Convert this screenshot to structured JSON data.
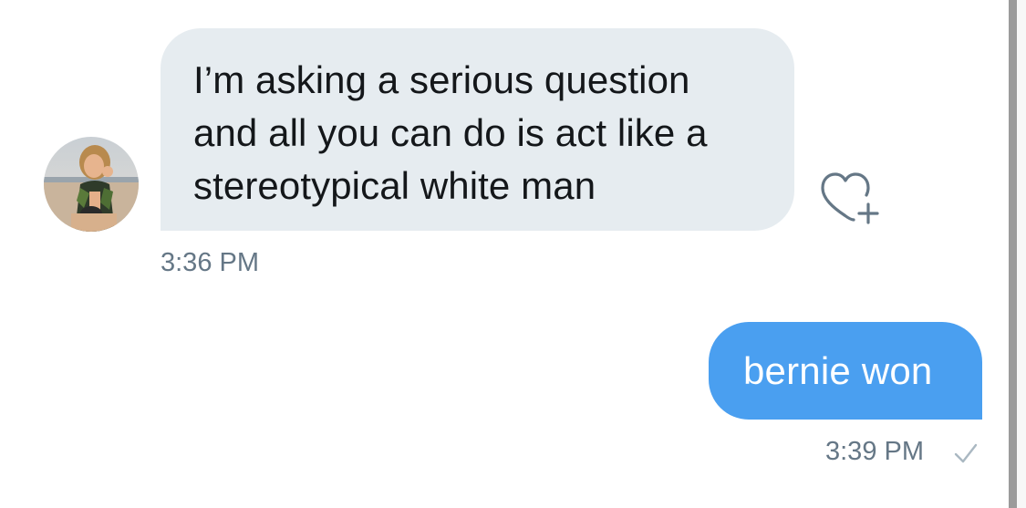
{
  "conversation": {
    "messages": [
      {
        "direction": "incoming",
        "text_lines": [
          "I’m asking a serious question",
          "and all you can do is act like a",
          "stereotypical white man"
        ],
        "time": "3:36 PM",
        "avatar_icon": "user-avatar",
        "action_icon": "heart-plus-icon"
      },
      {
        "direction": "outgoing",
        "text": "bernie won",
        "time": "3:39 PM",
        "status_icon": "checkmark-icon"
      }
    ]
  },
  "colors": {
    "incoming_bubble": "#e6ecf0",
    "outgoing_bubble": "#4a9ff0",
    "timestamp": "#657786",
    "message_text": "#14171a"
  }
}
